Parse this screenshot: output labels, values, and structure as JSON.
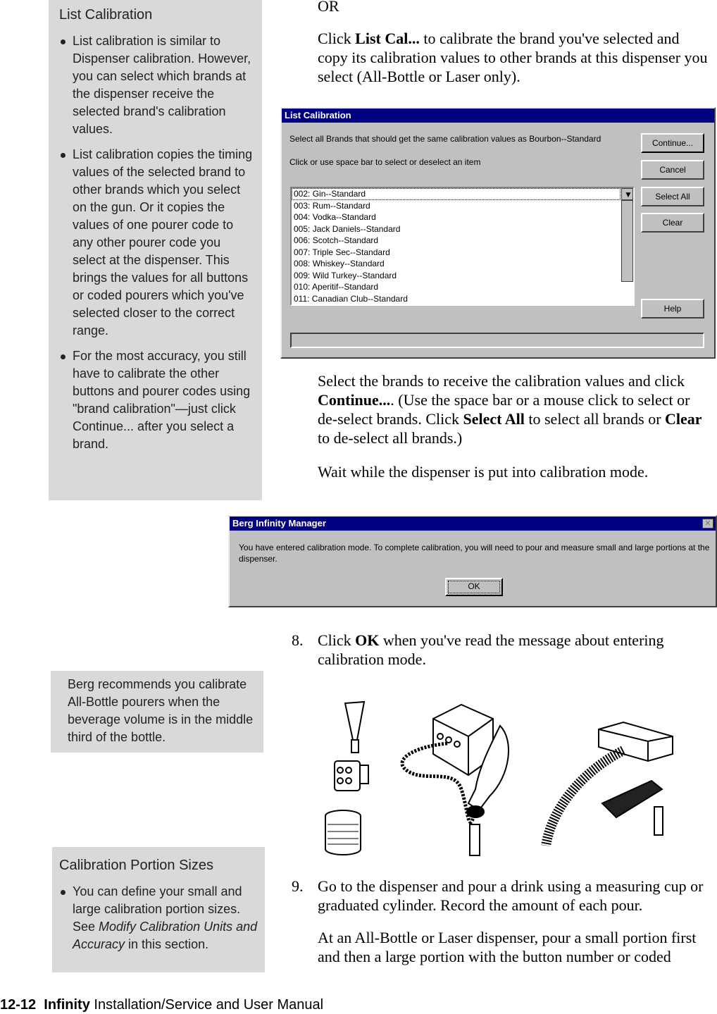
{
  "sidebar_notes": [
    {
      "title": "List Calibration",
      "items": [
        "List calibration is similar to Dispenser calibration. However, you can select which brands at the dispenser receive the selected brand's calibration values.",
        "List calibration copies the timing values of the selected brand to other brands which you select on the gun. Or it copies the values of one pourer code to any other pourer code you select at the dispenser. This brings the values for all buttons or coded pourers which you've selected closer to the correct range.",
        "For the most accuracy, you still have to calibrate the other buttons and pourer codes using \"brand calibration\"—just click Continue... after you  select a brand."
      ]
    },
    {
      "text": "Berg recommends you calibrate All-Bottle pourers when the beverage volume is in the middle third of the bottle."
    },
    {
      "title": "Calibration Portion Sizes",
      "item_pre": "You can define your small and large calibration portion sizes. See ",
      "item_em": "Modify Calibration Units and Accuracy",
      "item_post": " in this section."
    }
  ],
  "main": {
    "or": "OR",
    "p1_pre": "Click ",
    "p1_bold": "List Cal...",
    "p1_post": " to calibrate the brand you've selected and copy its calibration values to other brands at this dispenser you select (All-Bottle or Laser only).",
    "p2": {
      "a": "Select the brands to receive the calibration values and click ",
      "b": "Continue...",
      "c": ". (Use the space bar or a mouse click to select or de-select brands. Click ",
      "d": "Select All",
      "e": " to select all brands or ",
      "f": "Clear",
      "g": " to de-select all brands.)"
    },
    "p3": "Wait while the dispenser is put into calibration mode.",
    "step8": {
      "num": "8.",
      "a": "Click ",
      "b": "OK",
      "c": " when you've read the message about entering calibration mode."
    },
    "step9": {
      "num": "9.",
      "text": "Go to the dispenser and pour a drink using a measuring cup or graduated cylinder. Record the amount of each pour."
    },
    "p4": "At an All-Bottle or Laser dispenser, pour a small portion first and then a large portion with the button number or coded"
  },
  "list_dialog": {
    "title": "List Calibration",
    "instruction": "Select all Brands that should get the same calibration values as Bourbon--Standard",
    "hint": "Click or use space bar to select or deselect an item",
    "items": [
      "002: Gin--Standard",
      "003: Rum--Standard",
      "004: Vodka--Standard",
      "005: Jack Daniels--Standard",
      "006: Scotch--Standard",
      "007: Triple Sec--Standard",
      "008: Whiskey--Standard",
      "009: Wild Turkey--Standard",
      "010: Aperitif--Standard",
      "011: Canadian Club--Standard"
    ],
    "buttons": {
      "continue": "Continue...",
      "cancel": "Cancel",
      "select_all": "Select All",
      "clear": "Clear",
      "help": "Help"
    }
  },
  "message_box": {
    "title": "Berg Infinity Manager",
    "message": "You have entered calibration mode. To complete calibration, you will need to pour and measure small and large portions at the dispenser.",
    "ok": "OK"
  },
  "footer": {
    "page": "12-12",
    "product": "Infinity",
    "rest": " Installation/Service and User Manual"
  }
}
